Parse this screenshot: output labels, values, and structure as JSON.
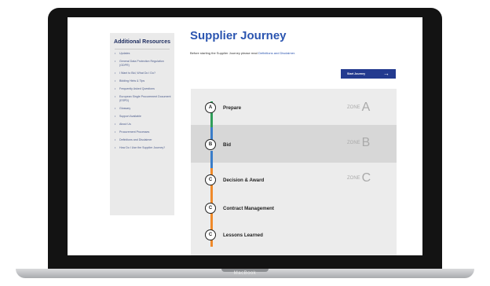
{
  "device": {
    "brand": "MacBook"
  },
  "sidebar": {
    "title": "Additional Resources",
    "items": [
      "Updates",
      "General Data Protection Regulation (GDPR)",
      "I Want to Bid, What Do I Do?",
      "Bidding Hints & Tips",
      "Frequently Asked Questions",
      "European Single Procurement Document (ESPD)",
      "Glossary",
      "Support Available",
      "About Us",
      "Procurement Processes",
      "Definitions and Disclaimer",
      "How Do I Use the Supplier Journey?"
    ]
  },
  "main": {
    "title": "Supplier Journey",
    "intro_text": "Before starting the Supplier Journey please read",
    "intro_link": "Definitions and Disclaimer.",
    "start_button": "Start Journey",
    "zones": [
      {
        "label": "ZONE",
        "letter": "A"
      },
      {
        "label": "ZONE",
        "letter": "B"
      },
      {
        "label": "ZONE",
        "letter": "C"
      }
    ],
    "stages": [
      {
        "letter": "A",
        "label": "Prepare"
      },
      {
        "letter": "B",
        "label": "Bid"
      },
      {
        "letter": "C",
        "label": "Decision & Award"
      },
      {
        "letter": "C",
        "label": "Contract Management"
      },
      {
        "letter": "C",
        "label": "Lessons Learned"
      }
    ]
  },
  "colors": {
    "title": "#2b55b0",
    "button": "#233a8f",
    "line_green": "#2f9e5a",
    "line_blue": "#3a7dc9",
    "line_orange": "#f08a2a"
  }
}
